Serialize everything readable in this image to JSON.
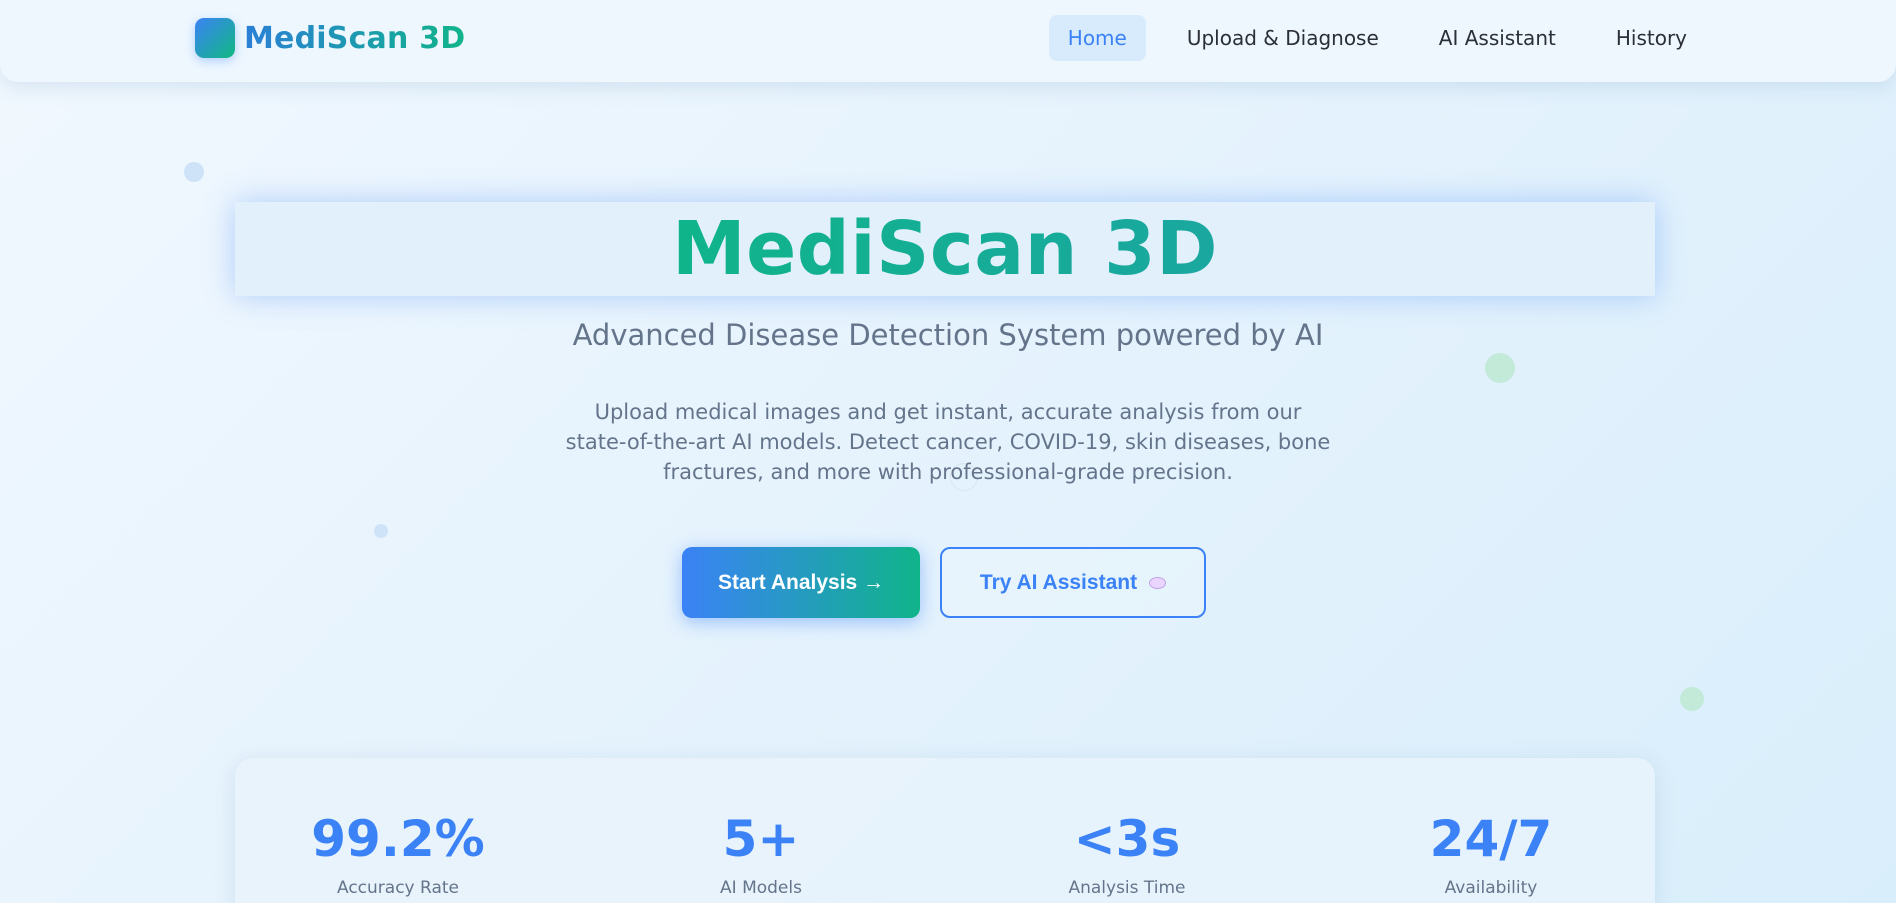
{
  "brand": {
    "name": "MediScan 3D",
    "logo_icon": "logo-square-icon"
  },
  "nav": {
    "items": [
      {
        "label": "Home",
        "active": true
      },
      {
        "label": "Upload & Diagnose",
        "active": false
      },
      {
        "label": "AI Assistant",
        "active": false
      },
      {
        "label": "History",
        "active": false
      }
    ]
  },
  "hero": {
    "title": "MediScan 3D",
    "subtitle": "Advanced Disease Detection System powered by AI",
    "description": "Upload medical images and get instant, accurate analysis from our state-of-the-art AI models. Detect cancer, COVID-19, skin diseases, bone fractures, and more with professional-grade precision.",
    "primary_button": "Start Analysis →",
    "secondary_button": "Try AI Assistant",
    "secondary_icon": "chat-bubble-icon"
  },
  "stats": [
    {
      "value": "99.2%",
      "label": "Accuracy Rate"
    },
    {
      "value": "5+",
      "label": "AI Models"
    },
    {
      "value": "<3s",
      "label": "Analysis Time"
    },
    {
      "value": "24/7",
      "label": "Availability"
    }
  ],
  "colors": {
    "accent_blue": "#3b82f6",
    "accent_green": "#10b48a",
    "text_muted": "#64748b"
  }
}
